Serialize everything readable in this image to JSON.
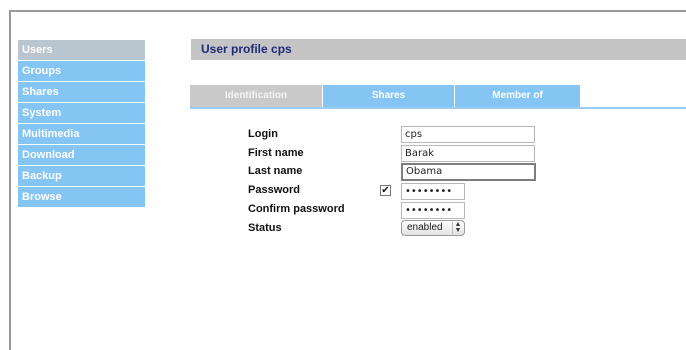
{
  "sidebar": {
    "items": [
      {
        "label": "Users",
        "active": true
      },
      {
        "label": "Groups"
      },
      {
        "label": "Shares"
      },
      {
        "label": "System"
      },
      {
        "label": "Multimedia"
      },
      {
        "label": "Download"
      },
      {
        "label": "Backup"
      },
      {
        "label": "Browse"
      }
    ]
  },
  "main": {
    "title": "User profile cps",
    "tabs": [
      {
        "label": "Identification",
        "selected": true
      },
      {
        "label": "Shares"
      },
      {
        "label": "Member of"
      }
    ],
    "form": {
      "login_label": "Login",
      "login_value": "cps",
      "first_name_label": "First name",
      "first_name_value": "Barak",
      "last_name_label": "Last name",
      "last_name_value": "Obama",
      "password_label": "Password",
      "password_checkbox": "✔",
      "password_value": "••••••••",
      "confirm_label": "Confirm password",
      "confirm_value": "••••••••",
      "status_label": "Status",
      "status_value": "enabled"
    }
  },
  "colors": {
    "sidebar_item": "#84c5f4",
    "sidebar_active": "#b9c5cf",
    "title_bar": "#c4c4c4",
    "title_text": "#1f2b78"
  }
}
